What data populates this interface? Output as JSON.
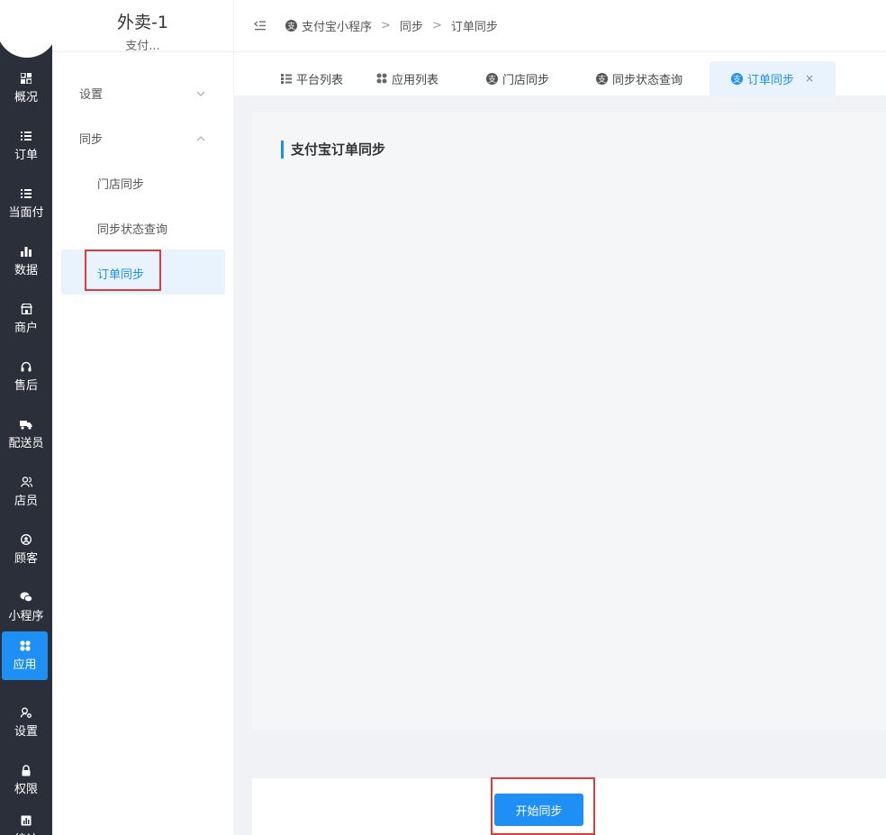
{
  "app": {
    "store_name": "外卖-1",
    "store_sub": "支付..."
  },
  "rail": {
    "items": [
      {
        "label": "概况",
        "icon": "dashboard-icon"
      },
      {
        "label": "订单",
        "icon": "list-icon"
      },
      {
        "label": "当面付",
        "icon": "list-icon"
      },
      {
        "label": "数据",
        "icon": "bar-chart-icon"
      },
      {
        "label": "商户",
        "icon": "store-icon"
      },
      {
        "label": "售后",
        "icon": "headset-icon"
      },
      {
        "label": "配送员",
        "icon": "delivery-icon"
      },
      {
        "label": "店员",
        "icon": "users-icon"
      },
      {
        "label": "顾客",
        "icon": "customer-icon"
      },
      {
        "label": "小程序",
        "icon": "wechat-icon"
      },
      {
        "label": "应用",
        "icon": "apps-icon"
      },
      {
        "label": "设置",
        "icon": "settings-icon"
      },
      {
        "label": "权限",
        "icon": "lock-icon"
      },
      {
        "label": "统计",
        "icon": "report-icon"
      }
    ],
    "active_index": 10
  },
  "sidebar": {
    "groups": [
      {
        "label": "设置",
        "state": "collapsed"
      },
      {
        "label": "同步",
        "state": "expanded"
      }
    ],
    "items": [
      {
        "label": "门店同步"
      },
      {
        "label": "同步状态查询"
      },
      {
        "label": "订单同步"
      }
    ],
    "active_item": "订单同步"
  },
  "breadcrumb": {
    "items": [
      "支付宝小程序",
      "同步",
      "订单同步"
    ]
  },
  "tabs": [
    {
      "label": "平台列表",
      "icon": "grid-list-icon"
    },
    {
      "label": "应用列表",
      "icon": "apps-icon"
    },
    {
      "label": "门店同步",
      "icon": "alipay-icon"
    },
    {
      "label": "同步状态查询",
      "icon": "alipay-icon"
    },
    {
      "label": "订单同步",
      "icon": "alipay-icon",
      "active": true,
      "close": "×"
    }
  ],
  "main": {
    "title": "支付宝订单同步",
    "start_button": "开始同步"
  },
  "colors": {
    "accent": "#1e8ff5",
    "rail_bg": "#2b2f3a",
    "highlight": "#e03a3a"
  }
}
